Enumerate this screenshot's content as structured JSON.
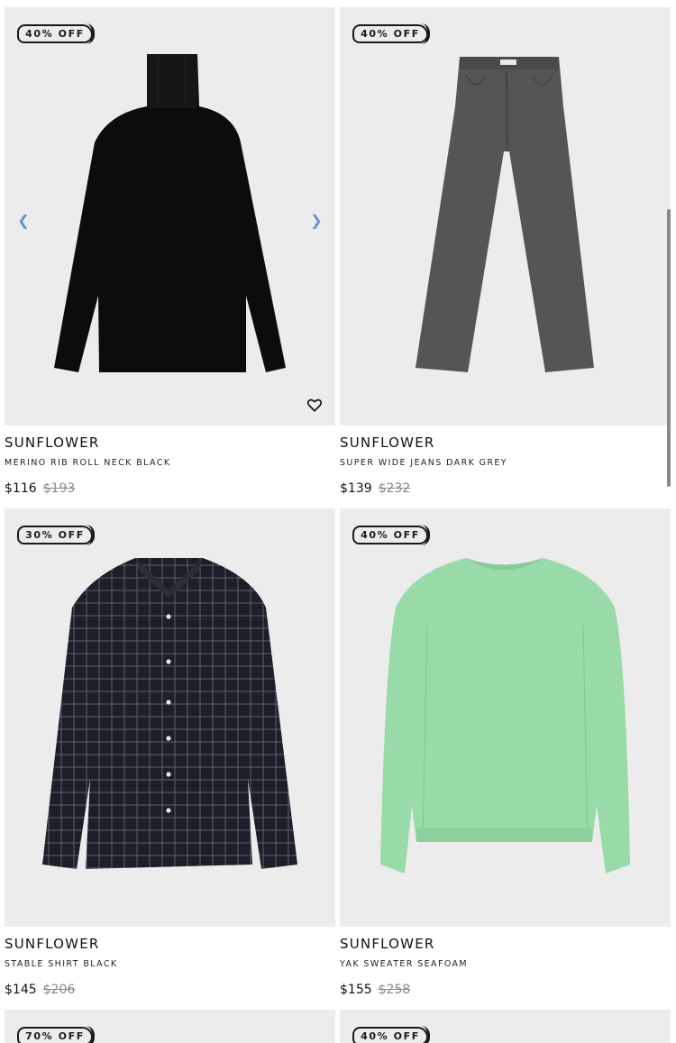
{
  "products": [
    {
      "badge": "40% OFF",
      "brand": "SUNFLOWER",
      "name": "MERINO RIB ROLL NECK BLACK",
      "price": "$116",
      "old_price": "$193",
      "image": "black-roll-neck-sweater"
    },
    {
      "badge": "40% OFF",
      "brand": "SUNFLOWER",
      "name": "SUPER WIDE JEANS DARK GREY",
      "price": "$139",
      "old_price": "$232",
      "image": "grey-wide-jeans"
    },
    {
      "badge": "30% OFF",
      "brand": "SUNFLOWER",
      "name": "STABLE SHIRT BLACK",
      "price": "$145",
      "old_price": "$206",
      "image": "black-check-shirt"
    },
    {
      "badge": "40% OFF",
      "brand": "SUNFLOWER",
      "name": "YAK SWEATER SEAFOAM",
      "price": "$155",
      "old_price": "$258",
      "image": "seafoam-sweater"
    },
    {
      "badge": "70% OFF",
      "image": "partial"
    },
    {
      "badge": "40% OFF",
      "image": "partial"
    }
  ],
  "icons": {
    "prev": "chevron-left-icon",
    "next": "chevron-right-icon",
    "wishlist": "heart-icon"
  },
  "colors": {
    "image_bg": "#ececec",
    "arrow": "#6a8fd8",
    "seafoam": "#98dba8"
  }
}
